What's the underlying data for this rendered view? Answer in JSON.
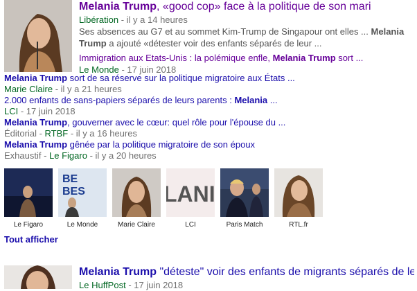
{
  "top_story": {
    "title_bold": "Melania Trump",
    "title_rest": ", «good cop» face à la politique de son mari",
    "source": "Libération",
    "date": " - il y a 14 heures",
    "snippet_1": "Ses absences au G7 et au sommet Kim-Trump de Singapour ont elles ...",
    "snippet_bold_1": "Melania",
    "snippet_bold_2": "Trump",
    "snippet_2": " a ajouté «détester voir des enfants séparés de leur ...",
    "related_title_a": "Immigration aux Etats-Unis : la polémique enfle, ",
    "related_title_bold": "Melania Trump",
    "related_title_b": " sort ...",
    "related_source": "Le Monde",
    "related_date": " - 17 juin 2018"
  },
  "list": [
    {
      "bold": "Melania Trump",
      "rest": " sort de sa réserve sur la politique migratoire aux États ...",
      "prefix": "",
      "source": "Marie Claire",
      "date": " - il y a 21 heures"
    },
    {
      "bold_pre": "2.000 enfants de sans-papiers séparés de leurs parents : ",
      "bold": "Melania",
      "rest": " ...",
      "prefix": "",
      "source": "LCI",
      "date": " - 17 juin 2018"
    },
    {
      "bold": "Melania Trump",
      "rest": ", gouverner avec le cœur: quel rôle pour l'épouse du ...",
      "prefix": "Éditorial - ",
      "source": "RTBF",
      "date": " - il y a 16 heures"
    },
    {
      "bold": "Melania Trump",
      "rest": " gênée par la politique migratoire de son époux",
      "prefix": "Exhaustif - ",
      "source": "Le Figaro",
      "date": " - il y a 20 heures"
    }
  ],
  "images": [
    {
      "caption": "Le Figaro"
    },
    {
      "caption": "Le Monde",
      "overlay_text": "BE\nBES"
    },
    {
      "caption": "Marie Claire"
    },
    {
      "caption": "LCI",
      "overlay_text": "LANI"
    },
    {
      "caption": "Paris Match"
    },
    {
      "caption": "RTL.fr"
    }
  ],
  "more_label": "Tout afficher",
  "second_story": {
    "title_bold": "Melania Trump",
    "title_rest": " \"déteste\" voir des enfants de migrants séparés de leur ...",
    "source": "Le HuffPost",
    "date": " - 17 juin 2018"
  },
  "colors": {
    "link": "#1a0dab",
    "visited": "#660099",
    "source": "#006621"
  }
}
